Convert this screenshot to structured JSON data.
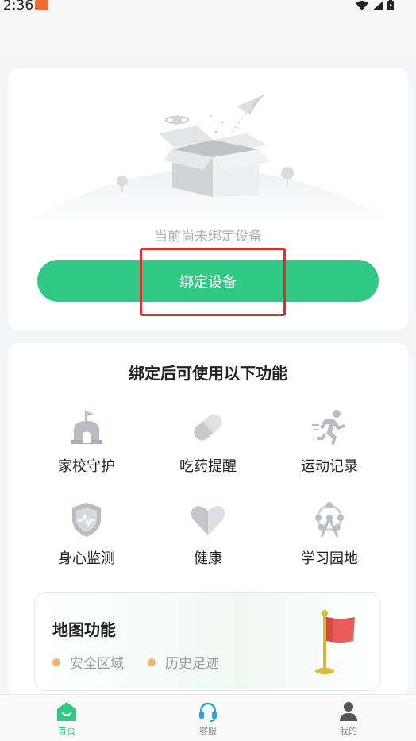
{
  "status_bar": {
    "time": "2:36"
  },
  "bind_card": {
    "empty_text": "当前尚未绑定设备",
    "bind_button_label": "绑定设备"
  },
  "features": {
    "title": "绑定后可使用以下功能",
    "items": [
      {
        "label": "家校守护",
        "icon": "school-icon"
      },
      {
        "label": "吃药提醒",
        "icon": "pill-icon"
      },
      {
        "label": "运动记录",
        "icon": "running-icon"
      },
      {
        "label": "身心监测",
        "icon": "heart-shield-icon"
      },
      {
        "label": "健康",
        "icon": "heart-icon"
      },
      {
        "label": "学习园地",
        "icon": "ferris-wheel-icon"
      }
    ]
  },
  "map_card": {
    "title": "地图功能",
    "tags": [
      "安全区域",
      "历史足迹"
    ]
  },
  "bottom_nav": {
    "items": [
      {
        "label": "首页",
        "icon": "home-icon",
        "active": true
      },
      {
        "label": "客服",
        "icon": "headset-icon",
        "active": false
      },
      {
        "label": "我的",
        "icon": "user-icon",
        "active": false
      }
    ]
  },
  "colors": {
    "accent": "#2fc985",
    "highlight": "#e32b2b",
    "icon_gray": "#b9bcc2",
    "tag_dot": "#f6b36b",
    "flag_red": "#ec5b5b"
  }
}
